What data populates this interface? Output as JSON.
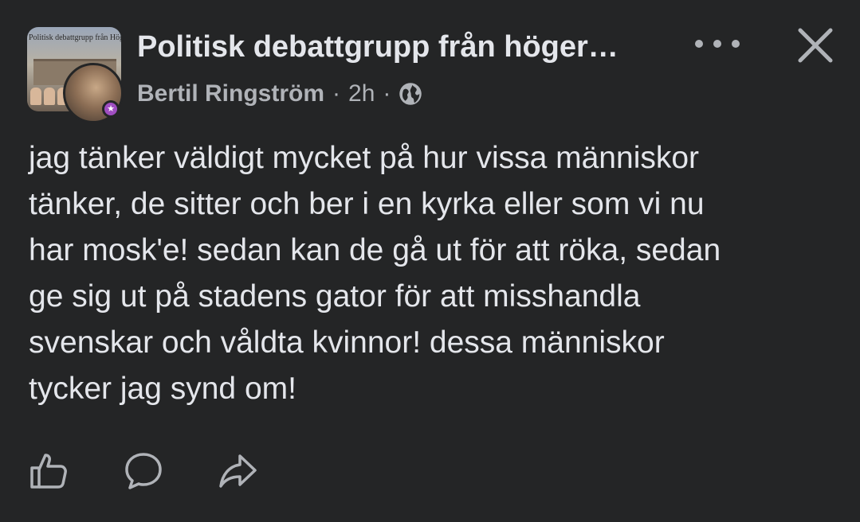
{
  "post": {
    "group_name": "Politisk debattgrupp från höger…",
    "group_thumbnail_caption": "Politisk debattgrupp från Höger till Vänster",
    "author": "Bertil Ringström",
    "separator": "·",
    "time": "2h",
    "audience_icon": "globe-icon",
    "text": "jag tänker väldigt mycket på hur vissa människor\ntänker, de sitter och ber i en kyrka eller som vi nu\nhar mosk'e! sedan kan de gå ut för att röka, sedan\nge sig ut på stadens gator för att misshandla\nsvenskar och våldta kvinnor! dessa människor\ntycker jag synd om!"
  },
  "header_actions": {
    "more_icon": "more-horizontal-icon",
    "close_icon": "close-icon"
  },
  "footer_actions": [
    {
      "icon": "like-icon"
    },
    {
      "icon": "comment-icon"
    },
    {
      "icon": "share-icon"
    }
  ],
  "colors": {
    "background": "#242526",
    "primary_text": "#e4e6eb",
    "secondary_text": "#b0b3b8",
    "icon": "#b0b3b8"
  }
}
